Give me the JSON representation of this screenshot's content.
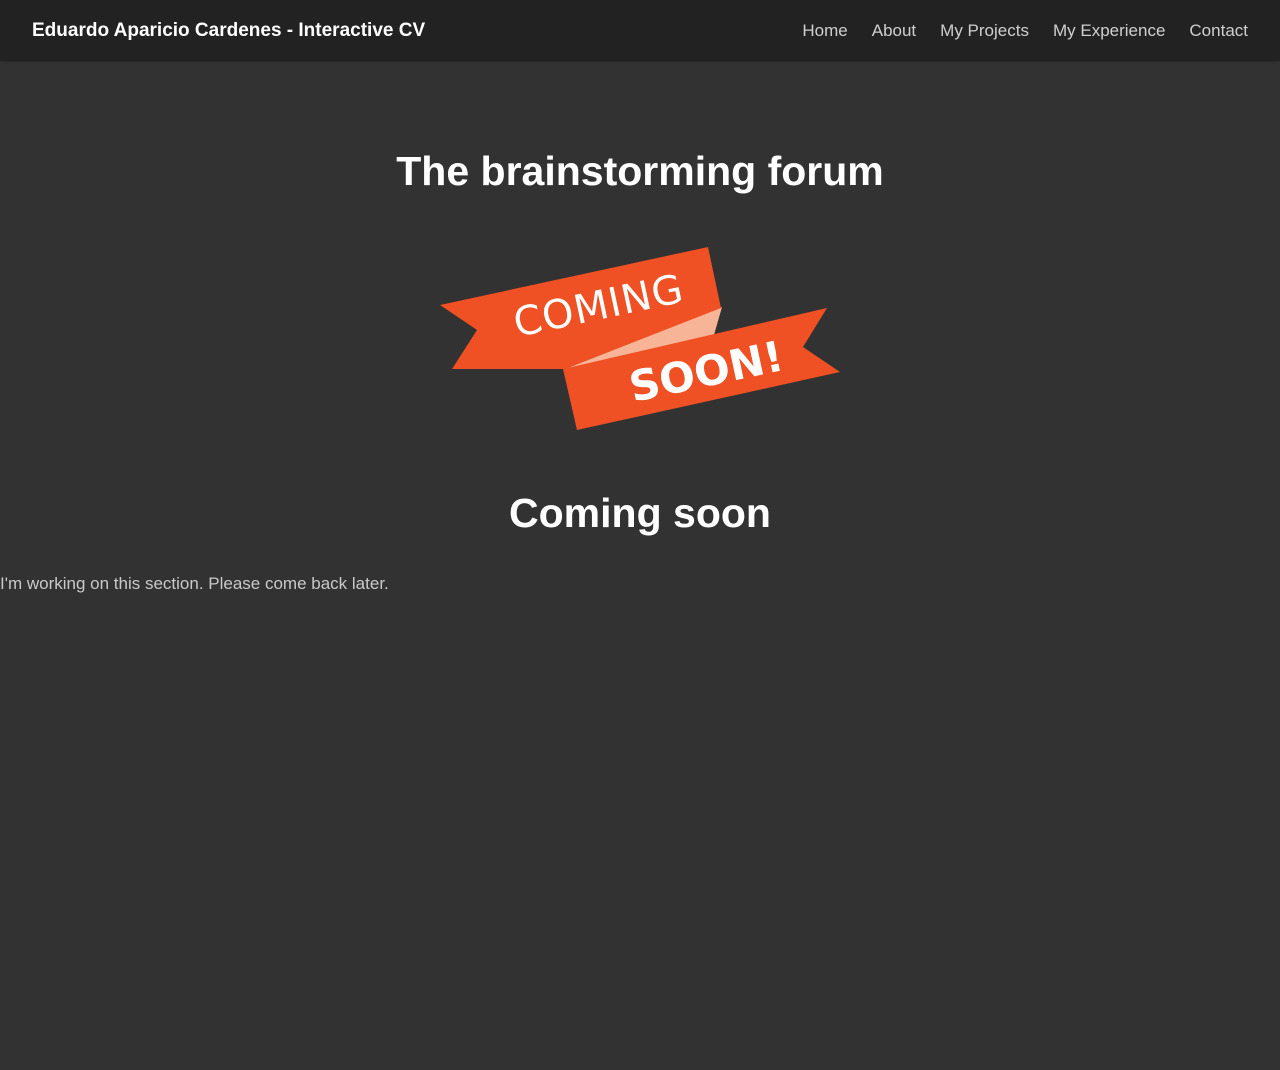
{
  "navbar": {
    "brand": "Eduardo Aparicio Cardenes - Interactive CV",
    "links": [
      {
        "label": "Home"
      },
      {
        "label": "About"
      },
      {
        "label": "My Projects"
      },
      {
        "label": "My Experience"
      },
      {
        "label": "Contact"
      }
    ]
  },
  "main": {
    "title": "The brainstorming forum",
    "banner": {
      "line1": "COMING",
      "line2": "SOON!",
      "ribbon_color": "#ef5024",
      "fold_color": "#f8b496"
    },
    "subtitle": "Coming soon",
    "message": "I'm working on this section. Please come back later."
  },
  "colors": {
    "background": "#323232",
    "navbar": "#222222",
    "nav_text": "#cfcfcf",
    "heading": "#ffffff"
  }
}
